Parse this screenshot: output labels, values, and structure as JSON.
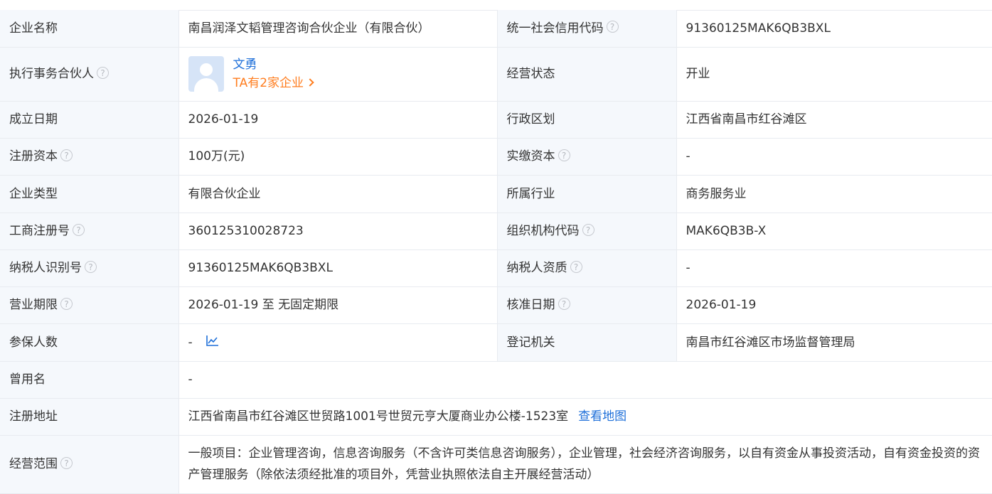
{
  "rows": [
    {
      "l1": "企业名称",
      "v1": "南昌润泽文韬管理咨询合伙企业（有限合伙）",
      "l2": "统一社会信用代码",
      "v2": "91360125MAK6QB3BXL"
    },
    {
      "l1": "执行事务合伙人",
      "partner_name": "文勇",
      "partner_count": "TA有2家企业",
      "l2": "经营状态",
      "v2": "开业"
    },
    {
      "l1": "成立日期",
      "v1": "2026-01-19",
      "l2": "行政区划",
      "v2": "江西省南昌市红谷滩区"
    },
    {
      "l1": "注册资本",
      "v1": "100万(元)",
      "l2": "实缴资本",
      "v2": "-"
    },
    {
      "l1": "企业类型",
      "v1": "有限合伙企业",
      "l2": "所属行业",
      "v2": "商务服务业"
    },
    {
      "l1": "工商注册号",
      "v1": "360125310028723",
      "l2": "组织机构代码",
      "v2": "MAK6QB3B-X"
    },
    {
      "l1": "纳税人识别号",
      "v1": "91360125MAK6QB3BXL",
      "l2": "纳税人资质",
      "v2": "-"
    },
    {
      "l1": "营业期限",
      "v1": "2026-01-19 至 无固定期限",
      "l2": "核准日期",
      "v2": "2026-01-19"
    },
    {
      "l1": "参保人数",
      "v1": "-",
      "l2": "登记机关",
      "v2": "南昌市红谷滩区市场监督管理局"
    },
    {
      "l1": "曾用名",
      "v1": "-"
    },
    {
      "l1": "注册地址",
      "v1": "江西省南昌市红谷滩区世贸路1001号世贸元亨大厦商业办公楼-1523室",
      "link": "查看地图"
    },
    {
      "l1": "经营范围",
      "v1": "一般项目：企业管理咨询，信息咨询服务（不含许可类信息咨询服务），企业管理，社会经济咨询服务，以自有资金从事投资活动，自有资金投资的资产管理服务（除依法须经批准的项目外，凭营业执照依法自主开展经营活动）"
    }
  ],
  "help_mark": "?",
  "icons": {
    "help": "question-circle-icon",
    "avatar": "person-avatar-icon",
    "trend": "line-chart-icon",
    "chevron": "chevron-right-icon"
  },
  "colors": {
    "label_bg": "#f5f8fc",
    "link": "#1e6fd9",
    "accent": "#ff7d1f",
    "border": "#e8ebf0"
  }
}
